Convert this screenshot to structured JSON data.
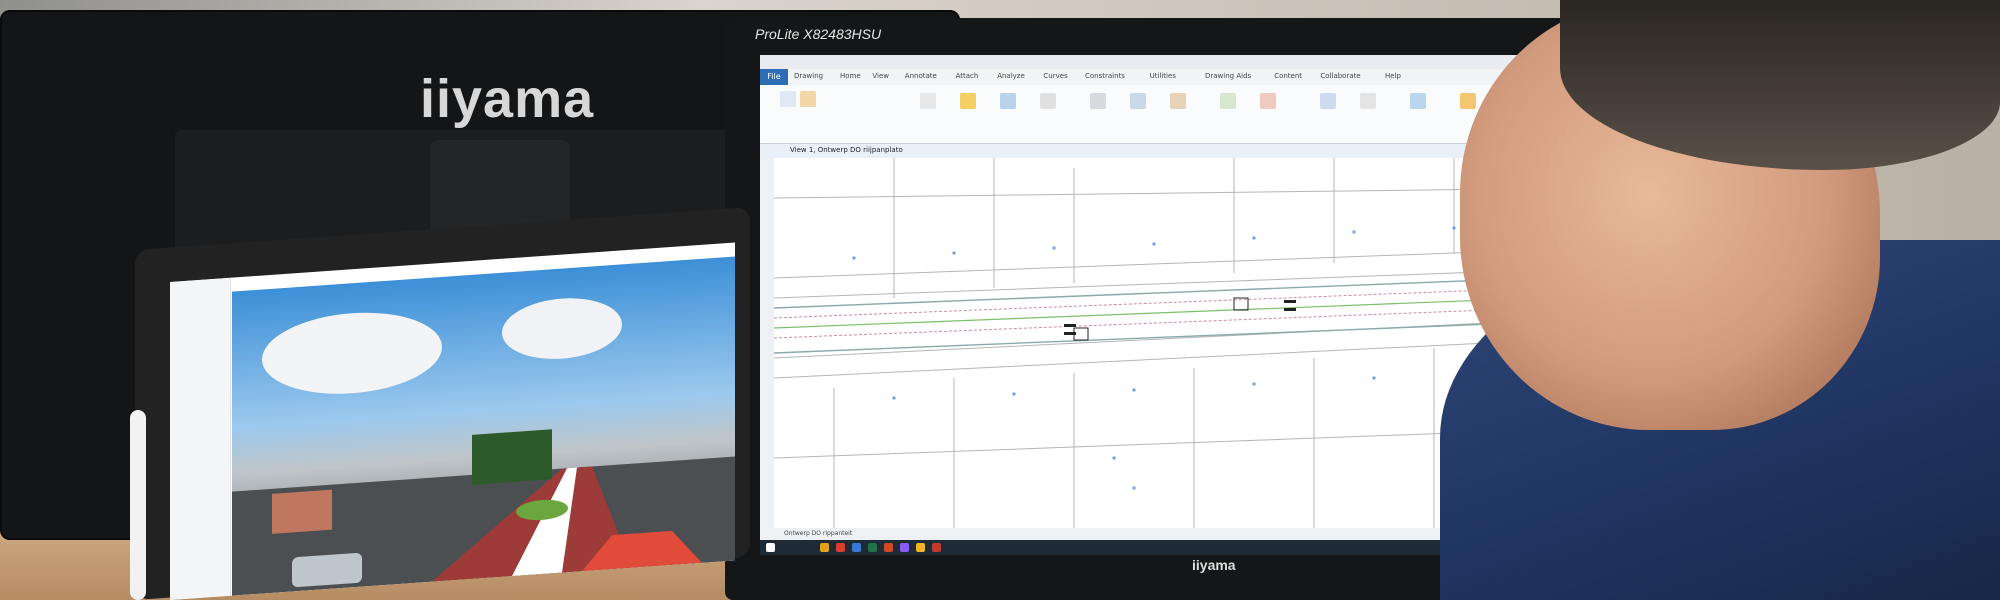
{
  "scene": {
    "back_monitor_brand": "iiyama",
    "main_monitor_model": "ProLite X82483HSU",
    "main_monitor_bottom_brand": "iiyama"
  },
  "cad_app": {
    "title": "Drawing",
    "file_tab": "File",
    "ribbon_tabs": [
      "Home",
      "View",
      "Annotate",
      "Attach",
      "Analyze",
      "Curves",
      "Constraints",
      "Utilities",
      "Drawing Aids",
      "Content",
      "Collaborate",
      "Help"
    ],
    "view_title": "View 1, Ontwerp DO riijpanplato",
    "drawing_tab": "Ontwerp DO rippanteit"
  },
  "colors": {
    "ribbon_accent": "#2e6db6",
    "taskbar": "#1f2a37",
    "shirt": "#1f3460"
  }
}
